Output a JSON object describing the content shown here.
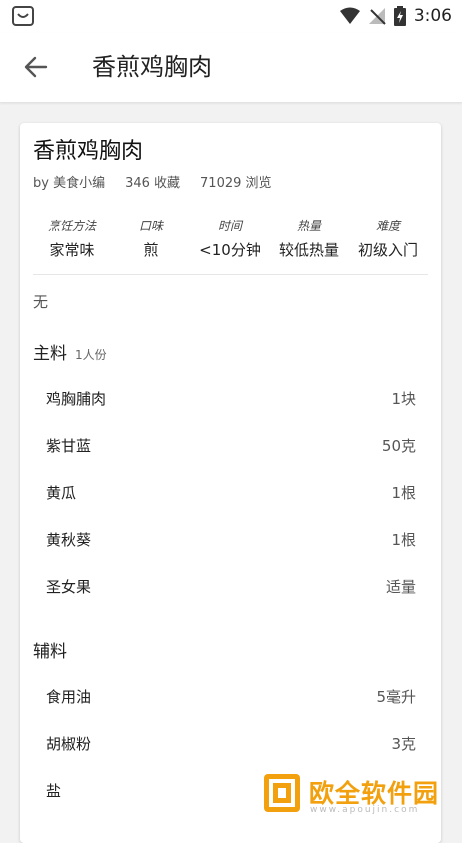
{
  "status_bar": {
    "time": "3:06"
  },
  "toolbar": {
    "title": "香煎鸡胸肉"
  },
  "recipe": {
    "title": "香煎鸡胸肉",
    "author": "by 美食小编",
    "favorites": "346 收藏",
    "views": "71029 浏览",
    "attributes": [
      {
        "label": "烹饪方法",
        "value": "家常味"
      },
      {
        "label": "口味",
        "value": "煎"
      },
      {
        "label": "时间",
        "value": "<10分钟"
      },
      {
        "label": "热量",
        "value": "较低热量"
      },
      {
        "label": "难度",
        "value": "初级入门"
      }
    ],
    "description": "无"
  },
  "main_ingredients": {
    "title": "主料",
    "servings": "1人份",
    "items": [
      {
        "name": "鸡胸脯肉",
        "amount": "1块"
      },
      {
        "name": "紫甘蓝",
        "amount": "50克"
      },
      {
        "name": "黄瓜",
        "amount": "1根"
      },
      {
        "name": "黄秋葵",
        "amount": "1根"
      },
      {
        "name": "圣女果",
        "amount": "适量"
      }
    ]
  },
  "secondary_ingredients": {
    "title": "辅料",
    "items": [
      {
        "name": "食用油",
        "amount": "5毫升"
      },
      {
        "name": "胡椒粉",
        "amount": "3克"
      },
      {
        "name": "盐",
        "amount": ""
      }
    ]
  },
  "watermark": {
    "text": "欧全软件园",
    "url": "www.apoujin.com"
  },
  "colors": {
    "accent": "#f2a00d",
    "background": "#f2f2f2"
  }
}
